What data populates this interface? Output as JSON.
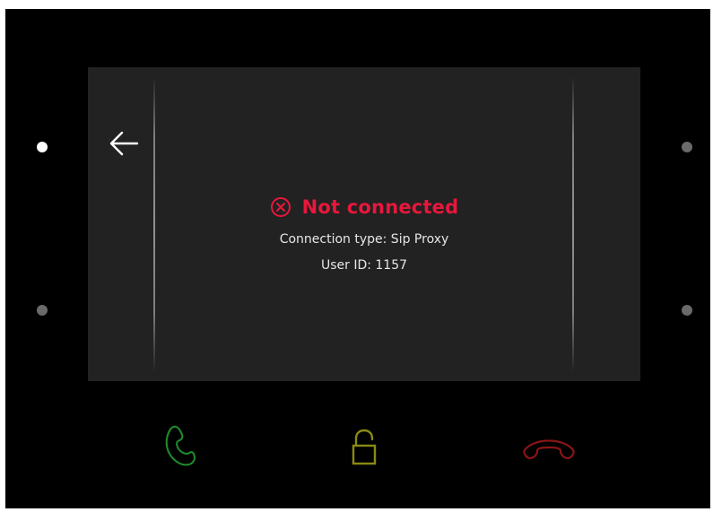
{
  "status": {
    "title": "Not connected",
    "icon": "circle-x-icon",
    "color": "#e8173c"
  },
  "info": {
    "connection_type": "Connection type: Sip Proxy",
    "user_id": "User ID: 1157"
  },
  "navigation": {
    "back_icon": "arrow-left-icon"
  },
  "hardware_buttons": [
    {
      "name": "answer-call",
      "icon": "phone-answer-icon",
      "color": "#1f8a2c"
    },
    {
      "name": "unlock-door",
      "icon": "padlock-open-icon",
      "color": "#8a8a12"
    },
    {
      "name": "hang-up",
      "icon": "phone-hangup-icon",
      "color": "#8a1515"
    }
  ],
  "colors": {
    "bezel": "#000000",
    "screen": "#222222",
    "text": "#e6e6e6"
  }
}
